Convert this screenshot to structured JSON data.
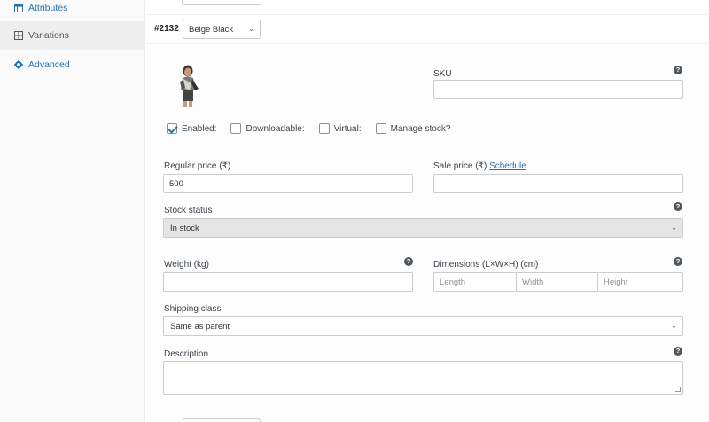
{
  "sidebar": {
    "items": [
      {
        "label": "Attributes",
        "icon": "table-icon"
      },
      {
        "label": "Variations",
        "icon": "grid-icon"
      },
      {
        "label": "Advanced",
        "icon": "gear-icon"
      }
    ]
  },
  "variation": {
    "id": "#2132",
    "selected": "Beige Black"
  },
  "fields": {
    "sku_label": "SKU",
    "enabled_label": "Enabled:",
    "downloadable_label": "Downloadable:",
    "virtual_label": "Virtual:",
    "manage_stock_label": "Manage stock?",
    "regular_price_label": "Regular price (₹)",
    "regular_price_value": "500",
    "sale_price_label": "Sale price (₹)",
    "schedule_link": "Schedule",
    "stock_status_label": "Stock status",
    "stock_status_value": "In stock",
    "weight_label": "Weight (kg)",
    "dimensions_label": "Dimensions (L×W×H) (cm)",
    "length_placeholder": "Length",
    "width_placeholder": "Width",
    "height_placeholder": "Height",
    "shipping_class_label": "Shipping class",
    "shipping_class_value": "Same as parent",
    "description_label": "Description"
  },
  "state": {
    "enabled": true,
    "downloadable": false,
    "virtual": false,
    "manage_stock": false
  },
  "colors": {
    "link": "#2271b1",
    "help_icon": "#50575e"
  }
}
